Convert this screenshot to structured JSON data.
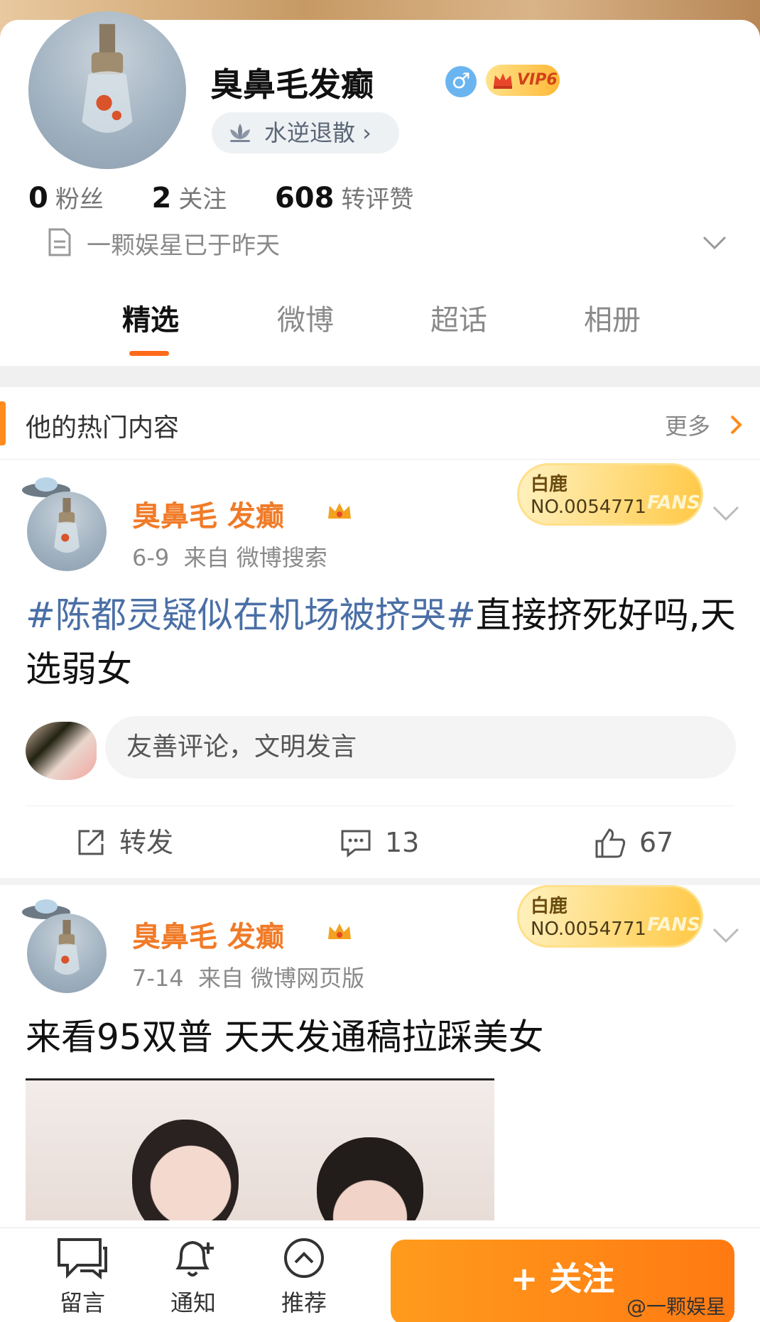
{
  "profile": {
    "username": "臭鼻毛发癫",
    "gender_symbol": "♂",
    "vip_label": "VIP6",
    "medal_label": "水逆退散 ›",
    "stats": [
      {
        "value": "0",
        "label": "粉丝"
      },
      {
        "value": "2",
        "label": "关注"
      },
      {
        "value": "608",
        "label": "转评赞"
      }
    ],
    "notice": "一颗娱星已于昨天"
  },
  "tabs": [
    {
      "label": "精选",
      "active": true
    },
    {
      "label": "微博",
      "active": false
    },
    {
      "label": "超话",
      "active": false
    },
    {
      "label": "相册",
      "active": false
    }
  ],
  "hot": {
    "title": "他的热门内容",
    "more": "更多"
  },
  "posts": [
    {
      "author": "臭鼻毛 发癫",
      "date": "6-9",
      "source": "来自 微博搜索",
      "fans_card": {
        "line1": "白鹿",
        "line2": "NO.0054771",
        "tag": "FANS"
      },
      "topic": "#陈都灵疑似在机场被挤哭#",
      "text": "直接挤死好吗,天选弱女",
      "comment_placeholder": "友善评论，文明发言",
      "actions": {
        "repost": "转发",
        "comments": "13",
        "likes": "67"
      }
    },
    {
      "author": "臭鼻毛 发癫",
      "date": "7-14",
      "source": "来自 微博网页版",
      "fans_card": {
        "line1": "白鹿",
        "line2": "NO.0054771",
        "tag": "FANS"
      },
      "text": "来看95双普 天天发通稿拉踩美女"
    }
  ],
  "bottom_bar": {
    "message": "留言",
    "notify": "通知",
    "recommend": "推荐",
    "follow": "+ 关注"
  },
  "watermark": "@一颗娱星",
  "colors": {
    "accent": "#ff7a12",
    "username_orange": "#f07b28",
    "topic_blue": "#4a6fa6"
  }
}
